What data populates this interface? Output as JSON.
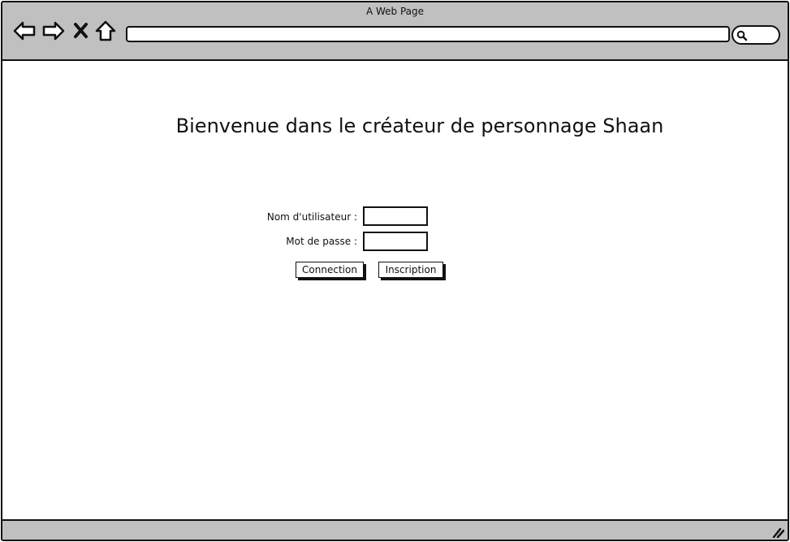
{
  "window": {
    "title": "A Web Page"
  },
  "toolbar": {
    "icons": [
      "back-arrow-icon",
      "forward-arrow-icon",
      "close-x-icon",
      "home-icon"
    ],
    "address_value": "",
    "search_icon": "magnifier-icon"
  },
  "page": {
    "heading": "Bienvenue dans le créateur de personnage Shaan"
  },
  "login_form": {
    "username_label": "Nom d'utilisateur :",
    "username_value": "",
    "password_label": "Mot de passe :",
    "password_value": "",
    "connect_label": "Connection",
    "register_label": "Inscription"
  },
  "colors": {
    "chrome": "#c0c0c0",
    "stroke": "#111111",
    "background": "#ffffff"
  }
}
